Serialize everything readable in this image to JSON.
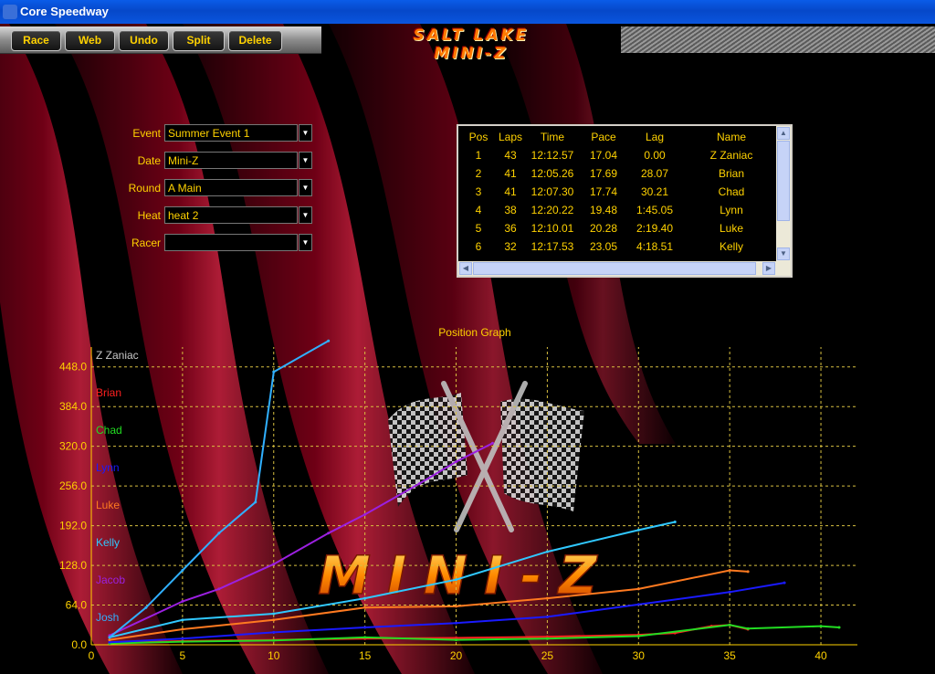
{
  "window": {
    "title": "Core Speedway"
  },
  "toolbar": {
    "buttons": [
      {
        "key": "race",
        "label": "Race"
      },
      {
        "key": "web",
        "label": "Web"
      },
      {
        "key": "undo",
        "label": "Undo"
      },
      {
        "key": "split",
        "label": "Split"
      },
      {
        "key": "delete",
        "label": "Delete"
      }
    ]
  },
  "logo": {
    "line1": "SALT LAKE",
    "line2": "MINI-Z"
  },
  "form": {
    "event": {
      "label": "Event",
      "value": "Summer Event 1"
    },
    "date": {
      "label": "Date",
      "value": "Mini-Z"
    },
    "round": {
      "label": "Round",
      "value": "A Main"
    },
    "heat": {
      "label": "Heat",
      "value": "heat 2"
    },
    "racer": {
      "label": "Racer",
      "value": ""
    }
  },
  "results": {
    "columns": [
      "Pos",
      "Laps",
      "Time",
      "Pace",
      "Lag",
      "Name"
    ],
    "rows": [
      [
        "1",
        "43",
        "12:12.57",
        "17.04",
        "0.00",
        "Z Zaniac"
      ],
      [
        "2",
        "41",
        "12:05.26",
        "17.69",
        "28.07",
        "Brian"
      ],
      [
        "3",
        "41",
        "12:07.30",
        "17.74",
        "30.21",
        "Chad"
      ],
      [
        "4",
        "38",
        "12:20.22",
        "19.48",
        "1:45.05",
        "Lynn"
      ],
      [
        "5",
        "36",
        "12:10.01",
        "20.28",
        "2:19.40",
        "Luke"
      ],
      [
        "6",
        "32",
        "12:17.53",
        "23.05",
        "4:18.51",
        "Kelly"
      ]
    ]
  },
  "colors": {
    "gold": "#ffd200",
    "grid": "#d8c040"
  },
  "chart_data": {
    "type": "line",
    "title": "Position Graph",
    "xlim": [
      0,
      42
    ],
    "ylim": [
      0,
      480
    ],
    "xticks": [
      "0",
      "5",
      "10",
      "15",
      "20",
      "25",
      "30",
      "35",
      "40"
    ],
    "yticks": [
      "0.0",
      "64.0",
      "128.0",
      "192.0",
      "256.0",
      "320.0",
      "384.0",
      "448.0"
    ],
    "grid": true,
    "legend_position": "left",
    "series": [
      {
        "name": "Z Zaniac",
        "color": "#c8c8c8",
        "x": [],
        "y": []
      },
      {
        "name": "Brian",
        "color": "#ff2020",
        "x": [
          1,
          5,
          10,
          15,
          20,
          25,
          30,
          32,
          34,
          35,
          36
        ],
        "y": [
          3,
          6,
          8,
          10,
          11,
          13,
          16,
          19,
          30,
          32,
          25
        ]
      },
      {
        "name": "Chad",
        "color": "#22dd22",
        "x": [
          1,
          5,
          10,
          15,
          20,
          25,
          30,
          35,
          36,
          40,
          41
        ],
        "y": [
          2,
          5,
          7,
          12,
          8,
          10,
          14,
          32,
          26,
          30,
          28
        ]
      },
      {
        "name": "Lynn",
        "color": "#1a1aff",
        "x": [
          1,
          5,
          10,
          15,
          20,
          25,
          30,
          35,
          38
        ],
        "y": [
          4,
          10,
          20,
          28,
          35,
          45,
          65,
          85,
          100
        ]
      },
      {
        "name": "Luke",
        "color": "#ff7a20",
        "x": [
          1,
          5,
          10,
          15,
          20,
          25,
          30,
          35,
          36
        ],
        "y": [
          8,
          25,
          40,
          60,
          62,
          75,
          90,
          120,
          118
        ]
      },
      {
        "name": "Kelly",
        "color": "#30c8ff",
        "x": [
          1,
          5,
          10,
          15,
          20,
          25,
          30,
          32
        ],
        "y": [
          12,
          40,
          50,
          75,
          105,
          150,
          185,
          198
        ]
      },
      {
        "name": "Jacob",
        "color": "#9b20e0",
        "x": [
          1,
          5,
          7,
          10,
          13,
          15,
          18,
          20,
          22
        ],
        "y": [
          15,
          70,
          90,
          130,
          180,
          210,
          260,
          295,
          325
        ]
      },
      {
        "name": "Josh",
        "color": "#30b0ff",
        "x": [
          1,
          3,
          5,
          7,
          9,
          10,
          13
        ],
        "y": [
          12,
          60,
          120,
          180,
          230,
          440,
          490
        ]
      }
    ]
  }
}
